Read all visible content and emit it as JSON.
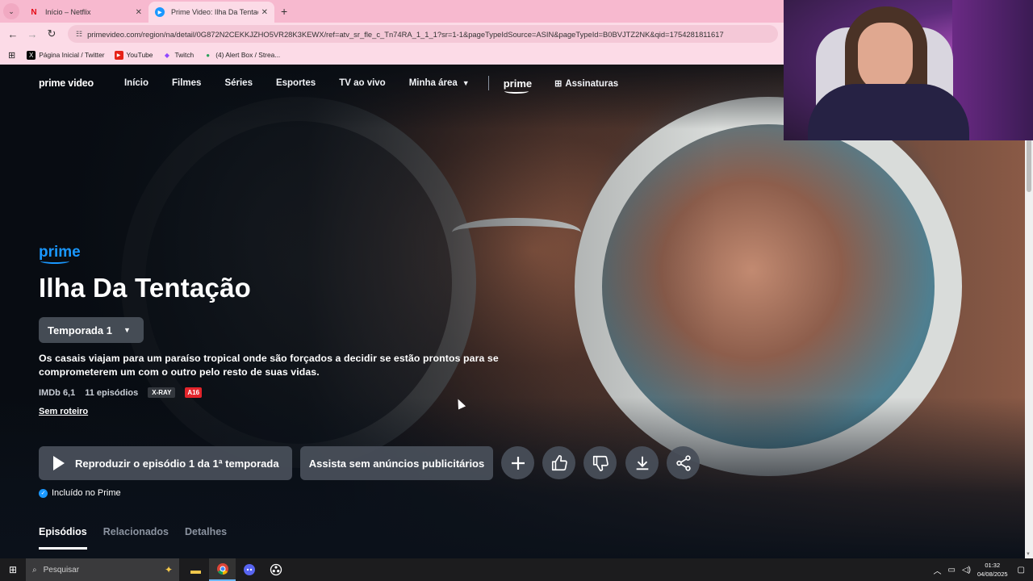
{
  "browser": {
    "tabs": [
      {
        "title": "Início – Netflix",
        "favicon": "N"
      },
      {
        "title": "Prime Video: Ilha Da Tentação",
        "favicon": "▶"
      }
    ],
    "url": "primevideo.com/region/na/detail/0G872N2CEKKJZHO5VR28K3KEWX/ref=atv_sr_fle_c_Tn74RA_1_1_1?sr=1-1&pageTypeIdSource=ASIN&pageTypeId=B0BVJTZ2NK&qid=1754281811617",
    "bookmarks": [
      {
        "label": "Página Inicial / Twitter",
        "icon": "X"
      },
      {
        "label": "YouTube",
        "icon": "▶"
      },
      {
        "label": "Twitch",
        "icon": "◆"
      },
      {
        "label": "(4) Alert Box / Strea...",
        "icon": "●"
      }
    ]
  },
  "nav": {
    "logo": "prime video",
    "items": [
      "Início",
      "Filmes",
      "Séries",
      "Esportes",
      "TV ao vivo",
      "Minha área"
    ],
    "prime_mini": "prime",
    "subscriptions": "Assinaturas"
  },
  "hero": {
    "badge": "prime",
    "title": "Ilha Da Tentação",
    "season": "Temporada 1",
    "synopsis": "Os casais viajam para um paraíso tropical onde são forçados a decidir se estão prontos para se comprometerem um com o outro pelo resto de suas vidas.",
    "imdb": "IMDb 6,1",
    "episodes": "11 episódios",
    "xray": "X-RAY",
    "age_rating": "A16",
    "no_script": "Sem roteiro",
    "play_label": "Reproduzir o episódio 1 da 1ª temporada",
    "ads_label": "Assista sem anúncios publicitários",
    "included": "Incluído no Prime"
  },
  "page_tabs": [
    "Episódios",
    "Relacionados",
    "Detalhes"
  ],
  "taskbar": {
    "search_placeholder": "Pesquisar",
    "time": "01:32",
    "date": "04/08/2025"
  },
  "colors": {
    "accent": "#1a98ff",
    "tab_bar": "#f7b9cf",
    "page_bg": "#0b111a"
  }
}
